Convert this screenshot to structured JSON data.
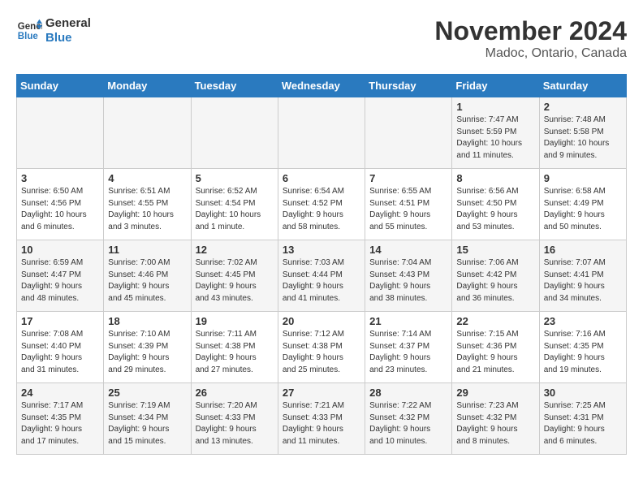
{
  "logo": {
    "line1": "General",
    "line2": "Blue"
  },
  "title": "November 2024",
  "location": "Madoc, Ontario, Canada",
  "weekdays": [
    "Sunday",
    "Monday",
    "Tuesday",
    "Wednesday",
    "Thursday",
    "Friday",
    "Saturday"
  ],
  "weeks": [
    [
      {
        "day": "",
        "info": ""
      },
      {
        "day": "",
        "info": ""
      },
      {
        "day": "",
        "info": ""
      },
      {
        "day": "",
        "info": ""
      },
      {
        "day": "",
        "info": ""
      },
      {
        "day": "1",
        "info": "Sunrise: 7:47 AM\nSunset: 5:59 PM\nDaylight: 10 hours\nand 11 minutes."
      },
      {
        "day": "2",
        "info": "Sunrise: 7:48 AM\nSunset: 5:58 PM\nDaylight: 10 hours\nand 9 minutes."
      }
    ],
    [
      {
        "day": "3",
        "info": "Sunrise: 6:50 AM\nSunset: 4:56 PM\nDaylight: 10 hours\nand 6 minutes."
      },
      {
        "day": "4",
        "info": "Sunrise: 6:51 AM\nSunset: 4:55 PM\nDaylight: 10 hours\nand 3 minutes."
      },
      {
        "day": "5",
        "info": "Sunrise: 6:52 AM\nSunset: 4:54 PM\nDaylight: 10 hours\nand 1 minute."
      },
      {
        "day": "6",
        "info": "Sunrise: 6:54 AM\nSunset: 4:52 PM\nDaylight: 9 hours\nand 58 minutes."
      },
      {
        "day": "7",
        "info": "Sunrise: 6:55 AM\nSunset: 4:51 PM\nDaylight: 9 hours\nand 55 minutes."
      },
      {
        "day": "8",
        "info": "Sunrise: 6:56 AM\nSunset: 4:50 PM\nDaylight: 9 hours\nand 53 minutes."
      },
      {
        "day": "9",
        "info": "Sunrise: 6:58 AM\nSunset: 4:49 PM\nDaylight: 9 hours\nand 50 minutes."
      }
    ],
    [
      {
        "day": "10",
        "info": "Sunrise: 6:59 AM\nSunset: 4:47 PM\nDaylight: 9 hours\nand 48 minutes."
      },
      {
        "day": "11",
        "info": "Sunrise: 7:00 AM\nSunset: 4:46 PM\nDaylight: 9 hours\nand 45 minutes."
      },
      {
        "day": "12",
        "info": "Sunrise: 7:02 AM\nSunset: 4:45 PM\nDaylight: 9 hours\nand 43 minutes."
      },
      {
        "day": "13",
        "info": "Sunrise: 7:03 AM\nSunset: 4:44 PM\nDaylight: 9 hours\nand 41 minutes."
      },
      {
        "day": "14",
        "info": "Sunrise: 7:04 AM\nSunset: 4:43 PM\nDaylight: 9 hours\nand 38 minutes."
      },
      {
        "day": "15",
        "info": "Sunrise: 7:06 AM\nSunset: 4:42 PM\nDaylight: 9 hours\nand 36 minutes."
      },
      {
        "day": "16",
        "info": "Sunrise: 7:07 AM\nSunset: 4:41 PM\nDaylight: 9 hours\nand 34 minutes."
      }
    ],
    [
      {
        "day": "17",
        "info": "Sunrise: 7:08 AM\nSunset: 4:40 PM\nDaylight: 9 hours\nand 31 minutes."
      },
      {
        "day": "18",
        "info": "Sunrise: 7:10 AM\nSunset: 4:39 PM\nDaylight: 9 hours\nand 29 minutes."
      },
      {
        "day": "19",
        "info": "Sunrise: 7:11 AM\nSunset: 4:38 PM\nDaylight: 9 hours\nand 27 minutes."
      },
      {
        "day": "20",
        "info": "Sunrise: 7:12 AM\nSunset: 4:38 PM\nDaylight: 9 hours\nand 25 minutes."
      },
      {
        "day": "21",
        "info": "Sunrise: 7:14 AM\nSunset: 4:37 PM\nDaylight: 9 hours\nand 23 minutes."
      },
      {
        "day": "22",
        "info": "Sunrise: 7:15 AM\nSunset: 4:36 PM\nDaylight: 9 hours\nand 21 minutes."
      },
      {
        "day": "23",
        "info": "Sunrise: 7:16 AM\nSunset: 4:35 PM\nDaylight: 9 hours\nand 19 minutes."
      }
    ],
    [
      {
        "day": "24",
        "info": "Sunrise: 7:17 AM\nSunset: 4:35 PM\nDaylight: 9 hours\nand 17 minutes."
      },
      {
        "day": "25",
        "info": "Sunrise: 7:19 AM\nSunset: 4:34 PM\nDaylight: 9 hours\nand 15 minutes."
      },
      {
        "day": "26",
        "info": "Sunrise: 7:20 AM\nSunset: 4:33 PM\nDaylight: 9 hours\nand 13 minutes."
      },
      {
        "day": "27",
        "info": "Sunrise: 7:21 AM\nSunset: 4:33 PM\nDaylight: 9 hours\nand 11 minutes."
      },
      {
        "day": "28",
        "info": "Sunrise: 7:22 AM\nSunset: 4:32 PM\nDaylight: 9 hours\nand 10 minutes."
      },
      {
        "day": "29",
        "info": "Sunrise: 7:23 AM\nSunset: 4:32 PM\nDaylight: 9 hours\nand 8 minutes."
      },
      {
        "day": "30",
        "info": "Sunrise: 7:25 AM\nSunset: 4:31 PM\nDaylight: 9 hours\nand 6 minutes."
      }
    ]
  ]
}
